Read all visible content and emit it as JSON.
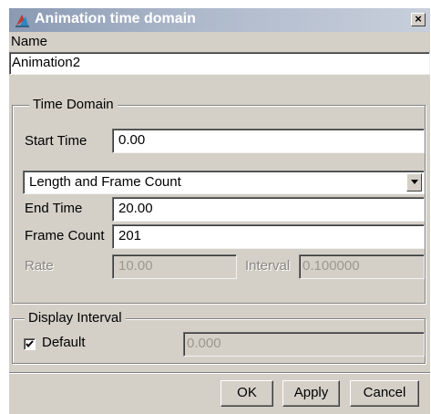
{
  "window": {
    "title": "Animation time domain",
    "close_glyph": "×"
  },
  "name_section": {
    "label": "Name",
    "value": "Animation2"
  },
  "time_domain": {
    "group_label": "Time Domain",
    "start_time_label": "Start Time",
    "start_time_value": "0.00",
    "mode_selected": "Length and Frame Count",
    "end_time_label": "End Time",
    "end_time_value": "20.00",
    "frame_count_label": "Frame Count",
    "frame_count_value": "201",
    "rate_label": "Rate",
    "rate_value": "10.00",
    "interval_label": "Interval",
    "interval_value": "0.100000"
  },
  "display_interval": {
    "group_label": "Display Interval",
    "default_label": "Default",
    "default_checked": true,
    "value": "0.000"
  },
  "buttons": {
    "ok": "OK",
    "apply": "Apply",
    "cancel": "Cancel"
  },
  "icons": {
    "app": "animation-app-icon",
    "close": "close-icon",
    "dropdown": "chevron-down-icon",
    "checkmark": "checkmark-icon"
  }
}
